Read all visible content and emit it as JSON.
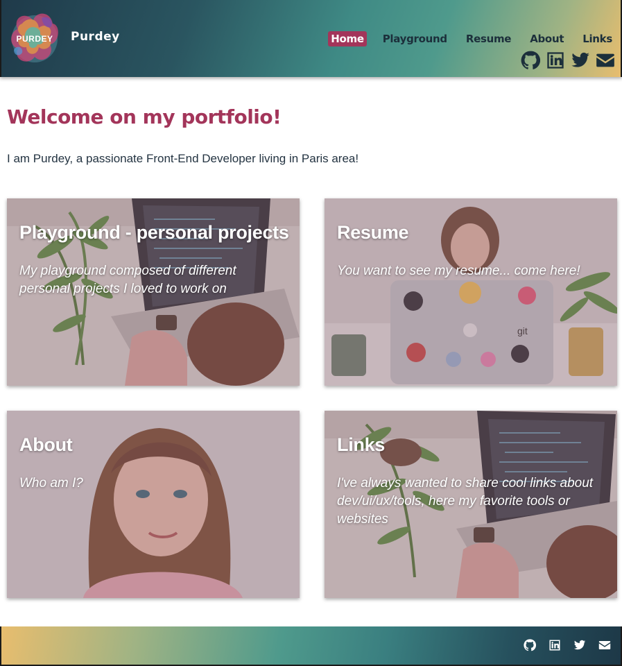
{
  "brand": {
    "logo_text": "PURDEY",
    "name": "Purdey"
  },
  "nav": {
    "items": [
      {
        "label": "Home",
        "active": true
      },
      {
        "label": "Playground",
        "active": false
      },
      {
        "label": "Resume",
        "active": false
      },
      {
        "label": "About",
        "active": false
      },
      {
        "label": "Links",
        "active": false
      }
    ]
  },
  "social": [
    "github-icon",
    "linkedin-icon",
    "twitter-icon",
    "envelope-icon"
  ],
  "main": {
    "title": "Welcome on my portfolio!",
    "intro": "I am Purdey, a passionate Front-End Developer living in Paris area!",
    "cards": [
      {
        "title": "Playground - personal projects",
        "text": "My playground composed of different personal projects I loved to work on"
      },
      {
        "title": "Resume",
        "text": "You want to see my resume... come here!"
      },
      {
        "title": "About",
        "text": "Who am I?"
      },
      {
        "title": "Links",
        "text": "I've always wanted to share cool links about dev/ui/ux/tools, here my favorite tools or websites"
      }
    ]
  },
  "colors": {
    "accent": "#a3355a",
    "nav_text": "#1c2f3b",
    "teal": "#4f9a8c",
    "gold": "#e8bd6e"
  }
}
